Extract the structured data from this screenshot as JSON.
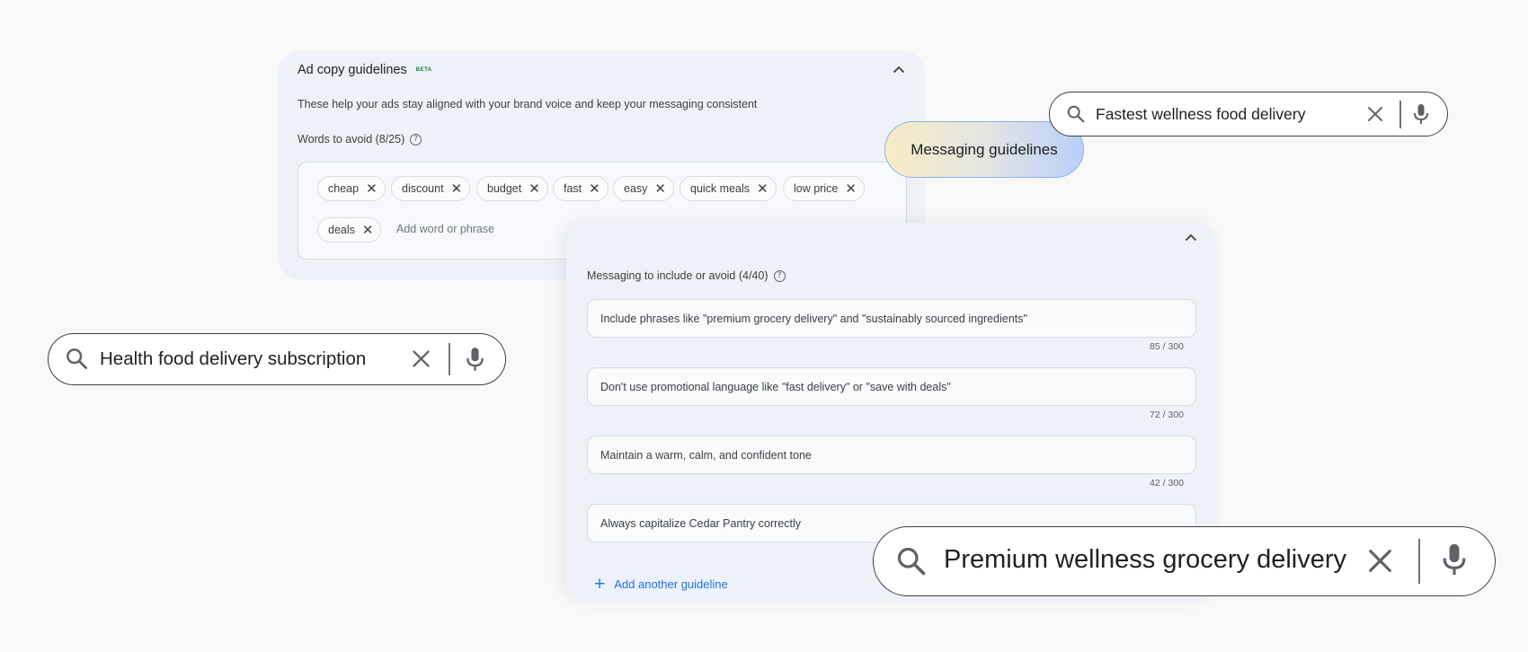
{
  "ad_copy": {
    "title": "Ad copy guidelines",
    "badge": "BETA",
    "description": "These help your ads stay aligned with your brand voice and keep your messaging consistent",
    "words_label": "Words to avoid (8/25)",
    "help_glyph": "?",
    "chips": [
      "cheap",
      "discount",
      "budget",
      "fast",
      "easy",
      "quick meals",
      "low price",
      "deals"
    ],
    "chip_remove_glyph": "✕",
    "add_placeholder": "Add word or phrase"
  },
  "messaging_pill": {
    "label": "Messaging guidelines"
  },
  "messaging": {
    "label": "Messaging to include or avoid (4/40)",
    "help_glyph": "?",
    "guidelines": [
      {
        "text": "Include phrases like \"premium grocery delivery\" and \"sustainably sourced ingredients\"",
        "count": "85 / 300"
      },
      {
        "text": "Don't use promotional language like \"fast delivery\" or \"save with deals\"",
        "count": "72 / 300"
      },
      {
        "text": "Maintain a warm, calm, and confident tone",
        "count": "42 / 300"
      },
      {
        "text": "Always capitalize Cedar Pantry correctly",
        "count": ""
      }
    ],
    "add_label": "Add another guideline",
    "add_glyph": "+"
  },
  "search_bars": {
    "top": {
      "query": "Fastest wellness food delivery"
    },
    "left": {
      "query": "Health food delivery subscription"
    },
    "bottom": {
      "query": "Premium wellness grocery delivery"
    }
  },
  "icons": {
    "search": "search-icon",
    "clear": "close-icon",
    "mic": "mic-icon",
    "collapse": "chevron-up-icon"
  },
  "colors": {
    "accent": "#1a73e8",
    "badge": "#188038",
    "card": "#eef1f7"
  }
}
